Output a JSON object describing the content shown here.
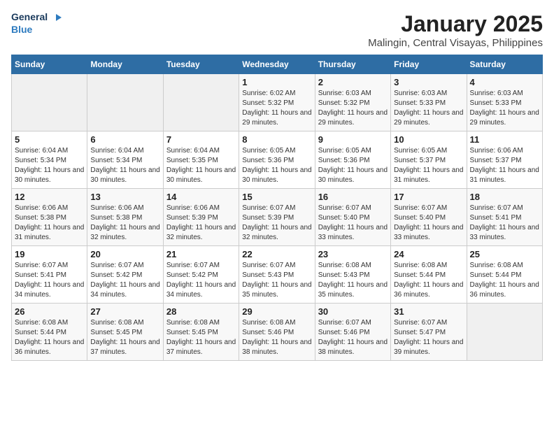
{
  "header": {
    "logo_line1": "General",
    "logo_line2": "Blue",
    "month": "January 2025",
    "location": "Malingin, Central Visayas, Philippines"
  },
  "weekdays": [
    "Sunday",
    "Monday",
    "Tuesday",
    "Wednesday",
    "Thursday",
    "Friday",
    "Saturday"
  ],
  "weeks": [
    [
      {
        "day": "",
        "info": ""
      },
      {
        "day": "",
        "info": ""
      },
      {
        "day": "",
        "info": ""
      },
      {
        "day": "1",
        "info": "Sunrise: 6:02 AM\nSunset: 5:32 PM\nDaylight: 11 hours and 29 minutes."
      },
      {
        "day": "2",
        "info": "Sunrise: 6:03 AM\nSunset: 5:32 PM\nDaylight: 11 hours and 29 minutes."
      },
      {
        "day": "3",
        "info": "Sunrise: 6:03 AM\nSunset: 5:33 PM\nDaylight: 11 hours and 29 minutes."
      },
      {
        "day": "4",
        "info": "Sunrise: 6:03 AM\nSunset: 5:33 PM\nDaylight: 11 hours and 29 minutes."
      }
    ],
    [
      {
        "day": "5",
        "info": "Sunrise: 6:04 AM\nSunset: 5:34 PM\nDaylight: 11 hours and 30 minutes."
      },
      {
        "day": "6",
        "info": "Sunrise: 6:04 AM\nSunset: 5:34 PM\nDaylight: 11 hours and 30 minutes."
      },
      {
        "day": "7",
        "info": "Sunrise: 6:04 AM\nSunset: 5:35 PM\nDaylight: 11 hours and 30 minutes."
      },
      {
        "day": "8",
        "info": "Sunrise: 6:05 AM\nSunset: 5:36 PM\nDaylight: 11 hours and 30 minutes."
      },
      {
        "day": "9",
        "info": "Sunrise: 6:05 AM\nSunset: 5:36 PM\nDaylight: 11 hours and 30 minutes."
      },
      {
        "day": "10",
        "info": "Sunrise: 6:05 AM\nSunset: 5:37 PM\nDaylight: 11 hours and 31 minutes."
      },
      {
        "day": "11",
        "info": "Sunrise: 6:06 AM\nSunset: 5:37 PM\nDaylight: 11 hours and 31 minutes."
      }
    ],
    [
      {
        "day": "12",
        "info": "Sunrise: 6:06 AM\nSunset: 5:38 PM\nDaylight: 11 hours and 31 minutes."
      },
      {
        "day": "13",
        "info": "Sunrise: 6:06 AM\nSunset: 5:38 PM\nDaylight: 11 hours and 32 minutes."
      },
      {
        "day": "14",
        "info": "Sunrise: 6:06 AM\nSunset: 5:39 PM\nDaylight: 11 hours and 32 minutes."
      },
      {
        "day": "15",
        "info": "Sunrise: 6:07 AM\nSunset: 5:39 PM\nDaylight: 11 hours and 32 minutes."
      },
      {
        "day": "16",
        "info": "Sunrise: 6:07 AM\nSunset: 5:40 PM\nDaylight: 11 hours and 33 minutes."
      },
      {
        "day": "17",
        "info": "Sunrise: 6:07 AM\nSunset: 5:40 PM\nDaylight: 11 hours and 33 minutes."
      },
      {
        "day": "18",
        "info": "Sunrise: 6:07 AM\nSunset: 5:41 PM\nDaylight: 11 hours and 33 minutes."
      }
    ],
    [
      {
        "day": "19",
        "info": "Sunrise: 6:07 AM\nSunset: 5:41 PM\nDaylight: 11 hours and 34 minutes."
      },
      {
        "day": "20",
        "info": "Sunrise: 6:07 AM\nSunset: 5:42 PM\nDaylight: 11 hours and 34 minutes."
      },
      {
        "day": "21",
        "info": "Sunrise: 6:07 AM\nSunset: 5:42 PM\nDaylight: 11 hours and 34 minutes."
      },
      {
        "day": "22",
        "info": "Sunrise: 6:07 AM\nSunset: 5:43 PM\nDaylight: 11 hours and 35 minutes."
      },
      {
        "day": "23",
        "info": "Sunrise: 6:08 AM\nSunset: 5:43 PM\nDaylight: 11 hours and 35 minutes."
      },
      {
        "day": "24",
        "info": "Sunrise: 6:08 AM\nSunset: 5:44 PM\nDaylight: 11 hours and 36 minutes."
      },
      {
        "day": "25",
        "info": "Sunrise: 6:08 AM\nSunset: 5:44 PM\nDaylight: 11 hours and 36 minutes."
      }
    ],
    [
      {
        "day": "26",
        "info": "Sunrise: 6:08 AM\nSunset: 5:44 PM\nDaylight: 11 hours and 36 minutes."
      },
      {
        "day": "27",
        "info": "Sunrise: 6:08 AM\nSunset: 5:45 PM\nDaylight: 11 hours and 37 minutes."
      },
      {
        "day": "28",
        "info": "Sunrise: 6:08 AM\nSunset: 5:45 PM\nDaylight: 11 hours and 37 minutes."
      },
      {
        "day": "29",
        "info": "Sunrise: 6:08 AM\nSunset: 5:46 PM\nDaylight: 11 hours and 38 minutes."
      },
      {
        "day": "30",
        "info": "Sunrise: 6:07 AM\nSunset: 5:46 PM\nDaylight: 11 hours and 38 minutes."
      },
      {
        "day": "31",
        "info": "Sunrise: 6:07 AM\nSunset: 5:47 PM\nDaylight: 11 hours and 39 minutes."
      },
      {
        "day": "",
        "info": ""
      }
    ]
  ]
}
